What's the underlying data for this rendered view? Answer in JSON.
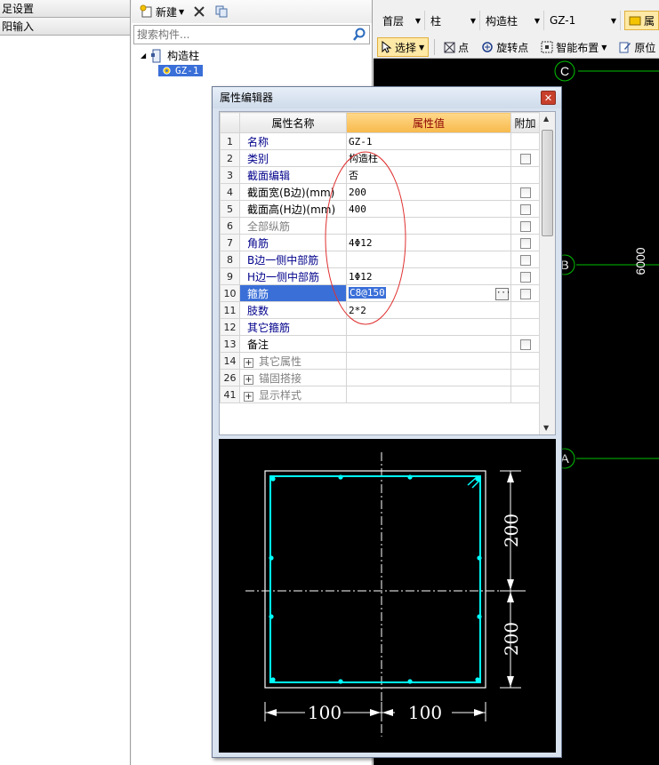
{
  "left_panel": {
    "items": [
      "足设置",
      "阳输入"
    ]
  },
  "component_panel": {
    "new_label": "新建",
    "search_placeholder": "搜索构件...",
    "tree": {
      "root_label": "构造柱",
      "child_label": "GZ-1"
    }
  },
  "toolbar": {
    "combos": [
      {
        "label": "首层"
      },
      {
        "label": "柱"
      },
      {
        "label": "构造柱"
      },
      {
        "label": "GZ-1"
      }
    ],
    "attr_button": "属",
    "select_label": "选择",
    "point_label": "点",
    "rotate_point_label": "旋转点",
    "smart_layout_label": "智能布置",
    "original_pos_label": "原位"
  },
  "canvas": {
    "axes": [
      {
        "label": "C"
      },
      {
        "label": "B"
      },
      {
        "label": "A"
      }
    ],
    "dimension_label": "6000",
    "grid_color": "#00c000"
  },
  "dialog": {
    "title": "属性编辑器",
    "headers": {
      "name": "属性名称",
      "value": "属性值",
      "attach": "附加"
    },
    "rows": [
      {
        "no": "1",
        "name": "名称",
        "value": "GZ-1",
        "color": "blue",
        "check": false
      },
      {
        "no": "2",
        "name": "类别",
        "value": "构造柱",
        "color": "blue",
        "check": true
      },
      {
        "no": "3",
        "name": "截面编辑",
        "value": "否",
        "color": "blue",
        "check": false
      },
      {
        "no": "4",
        "name": "截面宽(B边)(mm)",
        "value": "200",
        "color": "blk",
        "check": true
      },
      {
        "no": "5",
        "name": "截面高(H边)(mm)",
        "value": "400",
        "color": "blk",
        "check": true
      },
      {
        "no": "6",
        "name": "全部纵筋",
        "value": "",
        "color": "gray",
        "check": true
      },
      {
        "no": "7",
        "name": "角筋",
        "value": "4Φ12",
        "color": "blue",
        "check": true
      },
      {
        "no": "8",
        "name": "B边一侧中部筋",
        "value": "",
        "color": "blue",
        "check": true
      },
      {
        "no": "9",
        "name": "H边一侧中部筋",
        "value": "1Φ12",
        "color": "blue",
        "check": true
      },
      {
        "no": "10",
        "name": "箍筋",
        "value": "C8@150",
        "color": "blue",
        "check": true,
        "selected": true
      },
      {
        "no": "11",
        "name": "肢数",
        "value": "2*2",
        "color": "blue",
        "check": false
      },
      {
        "no": "12",
        "name": "其它箍筋",
        "value": "",
        "color": "blue",
        "check": false
      },
      {
        "no": "13",
        "name": "备注",
        "value": "",
        "color": "blk",
        "check": true
      },
      {
        "no": "14",
        "name": "其它属性",
        "value": "",
        "color": "gray",
        "group": true
      },
      {
        "no": "26",
        "name": "锚固搭接",
        "value": "",
        "color": "gray",
        "group": true
      },
      {
        "no": "41",
        "name": "显示样式",
        "value": "",
        "color": "gray",
        "group": true
      }
    ],
    "preview": {
      "dim_h_top": "200",
      "dim_h_bottom": "200",
      "dim_w_left": "100",
      "dim_w_right": "100"
    }
  }
}
